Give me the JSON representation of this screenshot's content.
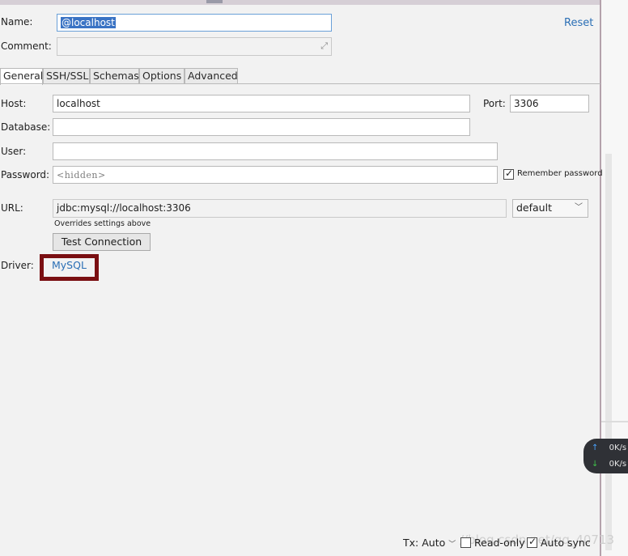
{
  "form": {
    "name_label": "Name:",
    "name_value": "@localhost",
    "comment_label": "Comment:",
    "comment_value": "",
    "reset_link": "Reset"
  },
  "tabs": [
    {
      "label": "General",
      "active": true
    },
    {
      "label": "SSH/SSL",
      "active": false
    },
    {
      "label": "Schemas",
      "active": false
    },
    {
      "label": "Options",
      "active": false
    },
    {
      "label": "Advanced",
      "active": false
    }
  ],
  "general": {
    "host_label": "Host:",
    "host_value": "localhost",
    "port_label": "Port:",
    "port_value": "3306",
    "database_label": "Database:",
    "database_value": "",
    "user_label": "User:",
    "user_value": "",
    "password_label": "Password:",
    "password_placeholder": "<hidden>",
    "remember_password_label": "Remember password",
    "remember_password_checked": true,
    "url_label": "URL:",
    "url_value": "jdbc:mysql://localhost:3306",
    "url_mode": "default",
    "url_hint": "Overrides settings above",
    "test_connection_button": "Test Connection",
    "driver_label": "Driver:",
    "driver_value": "MySQL"
  },
  "statusbar": {
    "tx_label": "Tx: Auto",
    "readonly_label": "Read-only",
    "readonly_checked": false,
    "autosync_label": "Auto sync",
    "autosync_checked": true
  },
  "net_widget": {
    "upload": "0K/s",
    "download": "0K/s"
  },
  "watermark": "//blog.csdn.net/qq_40713"
}
